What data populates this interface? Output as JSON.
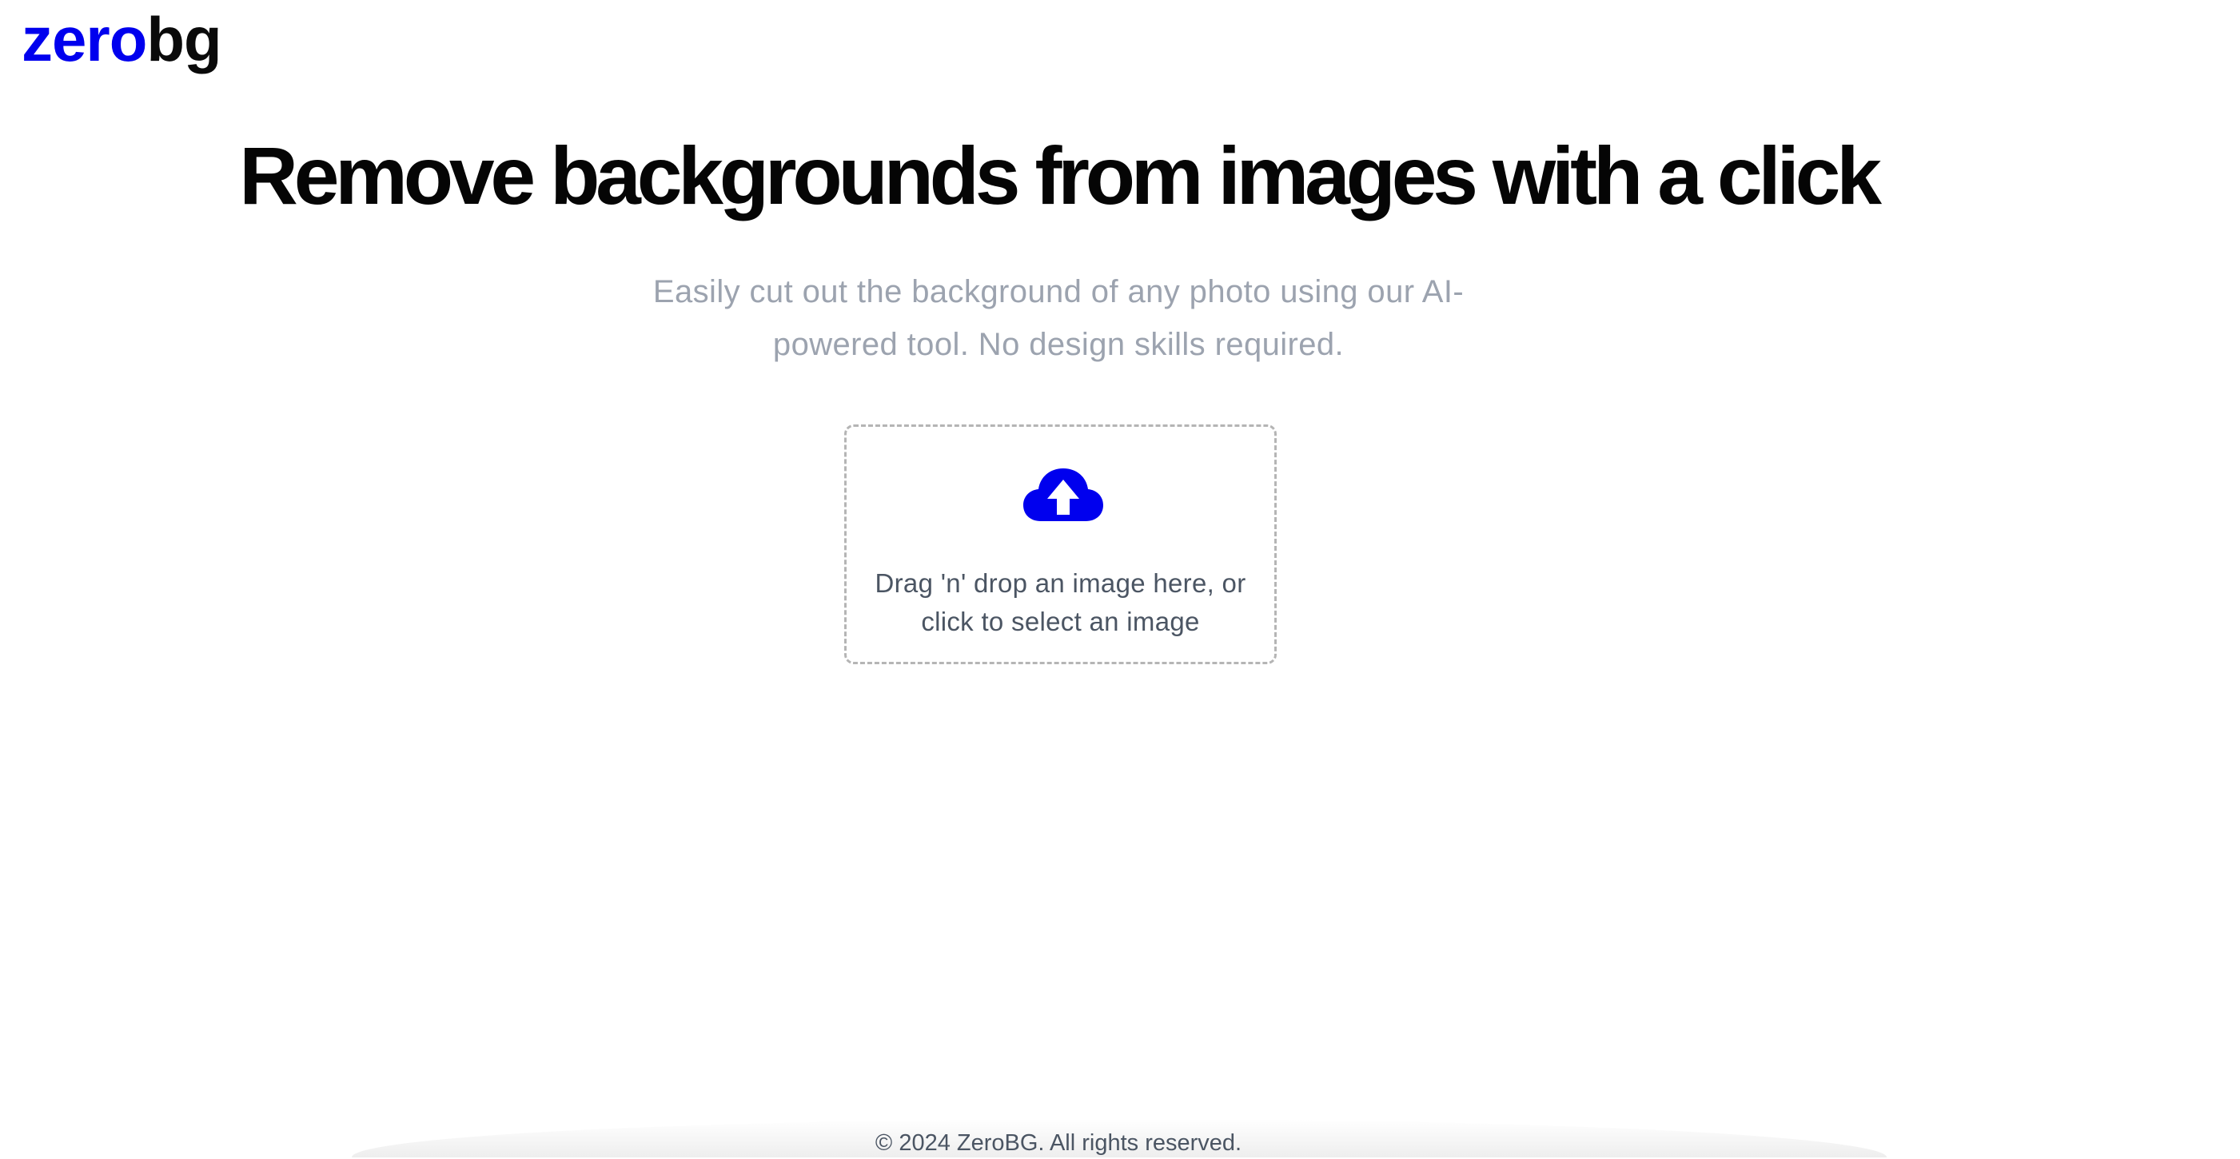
{
  "brand": {
    "logo_primary": "zero",
    "logo_secondary": "bg",
    "primary_color": "#0000ee",
    "secondary_color": "#0a0a0a"
  },
  "hero": {
    "title": "Remove backgrounds from images with a click",
    "subtitle": "Easily cut out the background of any photo using our AI-powered tool. No design skills required."
  },
  "upload": {
    "icon": "cloud-upload-icon",
    "instruction": "Drag 'n' drop an image here, or click to select an image"
  },
  "footer": {
    "copyright": "© 2024 ZeroBG. All rights reserved."
  }
}
